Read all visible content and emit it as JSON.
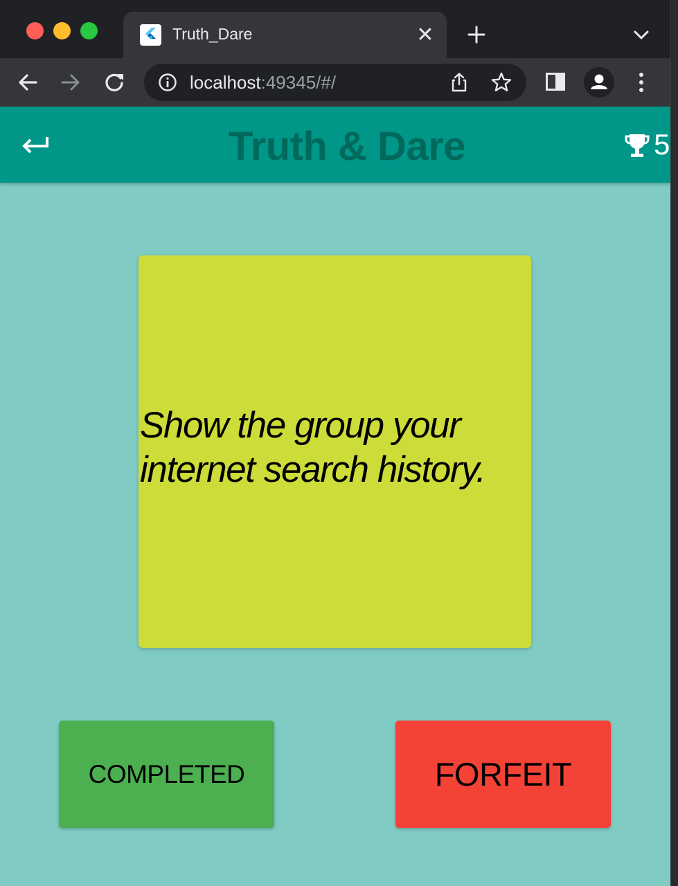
{
  "browser": {
    "tab_title": "Truth_Dare",
    "tab_close_glyph": "✕",
    "url_host": "localhost",
    "url_rest": ":49345/#/",
    "icons": [
      "back-arrow-icon",
      "forward-arrow-icon",
      "reload-icon",
      "info-icon",
      "share-icon",
      "star-icon",
      "side-panel-icon",
      "profile-icon",
      "more-vert-icon",
      "new-tab-icon",
      "chevron-down-icon",
      "flutter-logo-icon"
    ]
  },
  "app": {
    "title": "Truth & Dare",
    "score": "5",
    "card_text": "Show the group your internet search history.",
    "completed_label": "COMPLETED",
    "forfeit_label": "FORFEIT",
    "colors": {
      "app_bar": "#009688",
      "title": "#00695c",
      "background": "#80cbc4",
      "card": "#cddc39",
      "completed": "#4caf50",
      "forfeit": "#f44336"
    }
  }
}
